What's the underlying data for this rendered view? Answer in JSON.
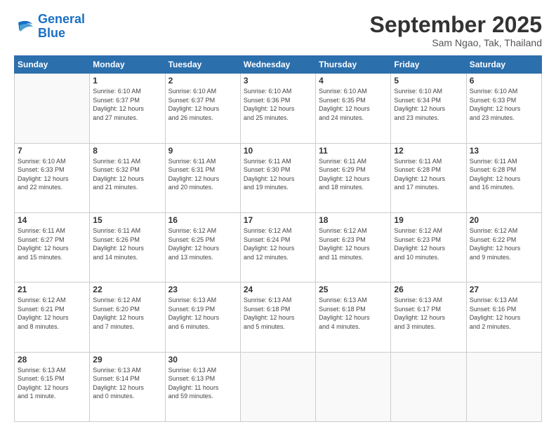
{
  "logo": {
    "line1": "General",
    "line2": "Blue"
  },
  "title": "September 2025",
  "location": "Sam Ngao, Tak, Thailand",
  "days_header": [
    "Sunday",
    "Monday",
    "Tuesday",
    "Wednesday",
    "Thursday",
    "Friday",
    "Saturday"
  ],
  "weeks": [
    [
      {
        "num": "",
        "info": ""
      },
      {
        "num": "1",
        "info": "Sunrise: 6:10 AM\nSunset: 6:37 PM\nDaylight: 12 hours\nand 27 minutes."
      },
      {
        "num": "2",
        "info": "Sunrise: 6:10 AM\nSunset: 6:37 PM\nDaylight: 12 hours\nand 26 minutes."
      },
      {
        "num": "3",
        "info": "Sunrise: 6:10 AM\nSunset: 6:36 PM\nDaylight: 12 hours\nand 25 minutes."
      },
      {
        "num": "4",
        "info": "Sunrise: 6:10 AM\nSunset: 6:35 PM\nDaylight: 12 hours\nand 24 minutes."
      },
      {
        "num": "5",
        "info": "Sunrise: 6:10 AM\nSunset: 6:34 PM\nDaylight: 12 hours\nand 23 minutes."
      },
      {
        "num": "6",
        "info": "Sunrise: 6:10 AM\nSunset: 6:33 PM\nDaylight: 12 hours\nand 23 minutes."
      }
    ],
    [
      {
        "num": "7",
        "info": "Sunrise: 6:10 AM\nSunset: 6:33 PM\nDaylight: 12 hours\nand 22 minutes."
      },
      {
        "num": "8",
        "info": "Sunrise: 6:11 AM\nSunset: 6:32 PM\nDaylight: 12 hours\nand 21 minutes."
      },
      {
        "num": "9",
        "info": "Sunrise: 6:11 AM\nSunset: 6:31 PM\nDaylight: 12 hours\nand 20 minutes."
      },
      {
        "num": "10",
        "info": "Sunrise: 6:11 AM\nSunset: 6:30 PM\nDaylight: 12 hours\nand 19 minutes."
      },
      {
        "num": "11",
        "info": "Sunrise: 6:11 AM\nSunset: 6:29 PM\nDaylight: 12 hours\nand 18 minutes."
      },
      {
        "num": "12",
        "info": "Sunrise: 6:11 AM\nSunset: 6:28 PM\nDaylight: 12 hours\nand 17 minutes."
      },
      {
        "num": "13",
        "info": "Sunrise: 6:11 AM\nSunset: 6:28 PM\nDaylight: 12 hours\nand 16 minutes."
      }
    ],
    [
      {
        "num": "14",
        "info": "Sunrise: 6:11 AM\nSunset: 6:27 PM\nDaylight: 12 hours\nand 15 minutes."
      },
      {
        "num": "15",
        "info": "Sunrise: 6:11 AM\nSunset: 6:26 PM\nDaylight: 12 hours\nand 14 minutes."
      },
      {
        "num": "16",
        "info": "Sunrise: 6:12 AM\nSunset: 6:25 PM\nDaylight: 12 hours\nand 13 minutes."
      },
      {
        "num": "17",
        "info": "Sunrise: 6:12 AM\nSunset: 6:24 PM\nDaylight: 12 hours\nand 12 minutes."
      },
      {
        "num": "18",
        "info": "Sunrise: 6:12 AM\nSunset: 6:23 PM\nDaylight: 12 hours\nand 11 minutes."
      },
      {
        "num": "19",
        "info": "Sunrise: 6:12 AM\nSunset: 6:23 PM\nDaylight: 12 hours\nand 10 minutes."
      },
      {
        "num": "20",
        "info": "Sunrise: 6:12 AM\nSunset: 6:22 PM\nDaylight: 12 hours\nand 9 minutes."
      }
    ],
    [
      {
        "num": "21",
        "info": "Sunrise: 6:12 AM\nSunset: 6:21 PM\nDaylight: 12 hours\nand 8 minutes."
      },
      {
        "num": "22",
        "info": "Sunrise: 6:12 AM\nSunset: 6:20 PM\nDaylight: 12 hours\nand 7 minutes."
      },
      {
        "num": "23",
        "info": "Sunrise: 6:13 AM\nSunset: 6:19 PM\nDaylight: 12 hours\nand 6 minutes."
      },
      {
        "num": "24",
        "info": "Sunrise: 6:13 AM\nSunset: 6:18 PM\nDaylight: 12 hours\nand 5 minutes."
      },
      {
        "num": "25",
        "info": "Sunrise: 6:13 AM\nSunset: 6:18 PM\nDaylight: 12 hours\nand 4 minutes."
      },
      {
        "num": "26",
        "info": "Sunrise: 6:13 AM\nSunset: 6:17 PM\nDaylight: 12 hours\nand 3 minutes."
      },
      {
        "num": "27",
        "info": "Sunrise: 6:13 AM\nSunset: 6:16 PM\nDaylight: 12 hours\nand 2 minutes."
      }
    ],
    [
      {
        "num": "28",
        "info": "Sunrise: 6:13 AM\nSunset: 6:15 PM\nDaylight: 12 hours\nand 1 minute."
      },
      {
        "num": "29",
        "info": "Sunrise: 6:13 AM\nSunset: 6:14 PM\nDaylight: 12 hours\nand 0 minutes."
      },
      {
        "num": "30",
        "info": "Sunrise: 6:13 AM\nSunset: 6:13 PM\nDaylight: 11 hours\nand 59 minutes."
      },
      {
        "num": "",
        "info": ""
      },
      {
        "num": "",
        "info": ""
      },
      {
        "num": "",
        "info": ""
      },
      {
        "num": "",
        "info": ""
      }
    ]
  ]
}
